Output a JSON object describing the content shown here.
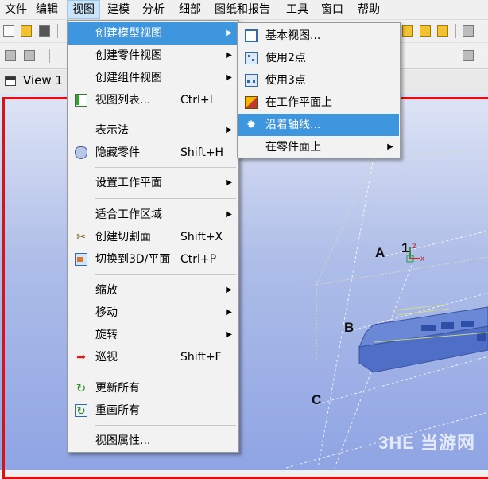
{
  "menubar": {
    "items": [
      "文件",
      "编辑",
      "视图",
      "建模",
      "分析",
      "细部",
      "图纸和报告",
      "工具",
      "窗口",
      "帮助"
    ],
    "active_index": 2
  },
  "view": {
    "tab_title": "View 1 -",
    "grid_labels": {
      "a": "A",
      "b": "B",
      "c": "C",
      "one": "1"
    },
    "axes": {
      "z": "z",
      "x": "x"
    }
  },
  "view_menu": {
    "items": [
      {
        "label": "创建模型视图",
        "shortcut": "",
        "submenu": true,
        "icon": ""
      },
      {
        "label": "创建零件视图",
        "shortcut": "",
        "submenu": true,
        "icon": ""
      },
      {
        "label": "创建组件视图",
        "shortcut": "",
        "submenu": true,
        "icon": ""
      },
      {
        "label": "视图列表...",
        "shortcut": "Ctrl+I",
        "submenu": false,
        "icon": "view-list-icon"
      },
      {
        "label": "表示法",
        "shortcut": "",
        "submenu": true,
        "icon": ""
      },
      {
        "label": "隐藏零件",
        "shortcut": "Shift+H",
        "submenu": false,
        "icon": "hide-parts-icon"
      },
      {
        "label": "设置工作平面",
        "shortcut": "",
        "submenu": true,
        "icon": ""
      },
      {
        "label": "适合工作区域",
        "shortcut": "",
        "submenu": true,
        "icon": ""
      },
      {
        "label": "创建切割面",
        "shortcut": "Shift+X",
        "submenu": false,
        "icon": "scissors-icon"
      },
      {
        "label": "切换到3D/平面",
        "shortcut": "Ctrl+P",
        "submenu": false,
        "icon": "switch-3d-icon"
      },
      {
        "label": "缩放",
        "shortcut": "",
        "submenu": true,
        "icon": ""
      },
      {
        "label": "移动",
        "shortcut": "",
        "submenu": true,
        "icon": ""
      },
      {
        "label": "旋转",
        "shortcut": "",
        "submenu": true,
        "icon": ""
      },
      {
        "label": "巡视",
        "shortcut": "Shift+F",
        "submenu": false,
        "icon": "walkthrough-icon"
      },
      {
        "label": "更新所有",
        "shortcut": "",
        "submenu": false,
        "icon": "update-all-icon"
      },
      {
        "label": "重画所有",
        "shortcut": "",
        "submenu": false,
        "icon": "redraw-all-icon"
      },
      {
        "label": "视图属性...",
        "shortcut": "",
        "submenu": false,
        "icon": ""
      }
    ],
    "highlighted_index": 0
  },
  "model_view_submenu": {
    "items": [
      {
        "label": "基本视图...",
        "icon": "basic-view-icon",
        "submenu": false
      },
      {
        "label": "使用2点",
        "icon": "two-points-icon",
        "submenu": false
      },
      {
        "label": "使用3点",
        "icon": "three-points-icon",
        "submenu": false
      },
      {
        "label": "在工作平面上",
        "icon": "work-plane-icon",
        "submenu": false
      },
      {
        "label": "沿着轴线...",
        "icon": "along-axis-icon",
        "submenu": false
      },
      {
        "label": "在零件面上",
        "icon": "",
        "submenu": true
      }
    ],
    "highlighted_index": 4
  },
  "watermark": "3HE 当游网",
  "colors": {
    "highlight": "#3e96de",
    "viewport_border": "#e01010",
    "viewport_bg": "#aebde8"
  }
}
